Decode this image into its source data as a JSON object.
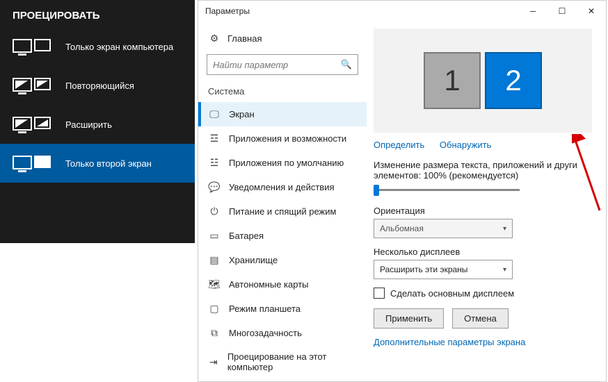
{
  "projectPanel": {
    "title": "ПРОЕЦИРОВАТЬ",
    "items": [
      {
        "label": "Только экран компьютера"
      },
      {
        "label": "Повторяющийся"
      },
      {
        "label": "Расширить"
      },
      {
        "label": "Только второй экран"
      }
    ]
  },
  "settings": {
    "windowTitle": "Параметры",
    "home": "Главная",
    "searchPlaceholder": "Найти параметр",
    "section": "Система",
    "nav": [
      {
        "label": "Экран",
        "selected": true
      },
      {
        "label": "Приложения и возможности"
      },
      {
        "label": "Приложения по умолчанию"
      },
      {
        "label": "Уведомления и действия"
      },
      {
        "label": "Питание и спящий режим"
      },
      {
        "label": "Батарея"
      },
      {
        "label": "Хранилище"
      },
      {
        "label": "Автономные карты"
      },
      {
        "label": "Режим планшета"
      },
      {
        "label": "Многозадачность"
      },
      {
        "label": "Проецирование на этот компьютер"
      }
    ],
    "display": {
      "monitor1": "1",
      "monitor2": "2",
      "identify": "Определить",
      "detect": "Обнаружить",
      "scaleLabel": "Изменение размера текста, приложений и други элементов: 100% (рекомендуется)",
      "orientationLabel": "Ориентация",
      "orientationValue": "Альбомная",
      "multipleLabel": "Несколько дисплеев",
      "multipleValue": "Расширить эти экраны",
      "makeMain": "Сделать основным дисплеем",
      "apply": "Применить",
      "cancel": "Отмена",
      "advanced": "Дополнительные параметры экрана"
    }
  }
}
